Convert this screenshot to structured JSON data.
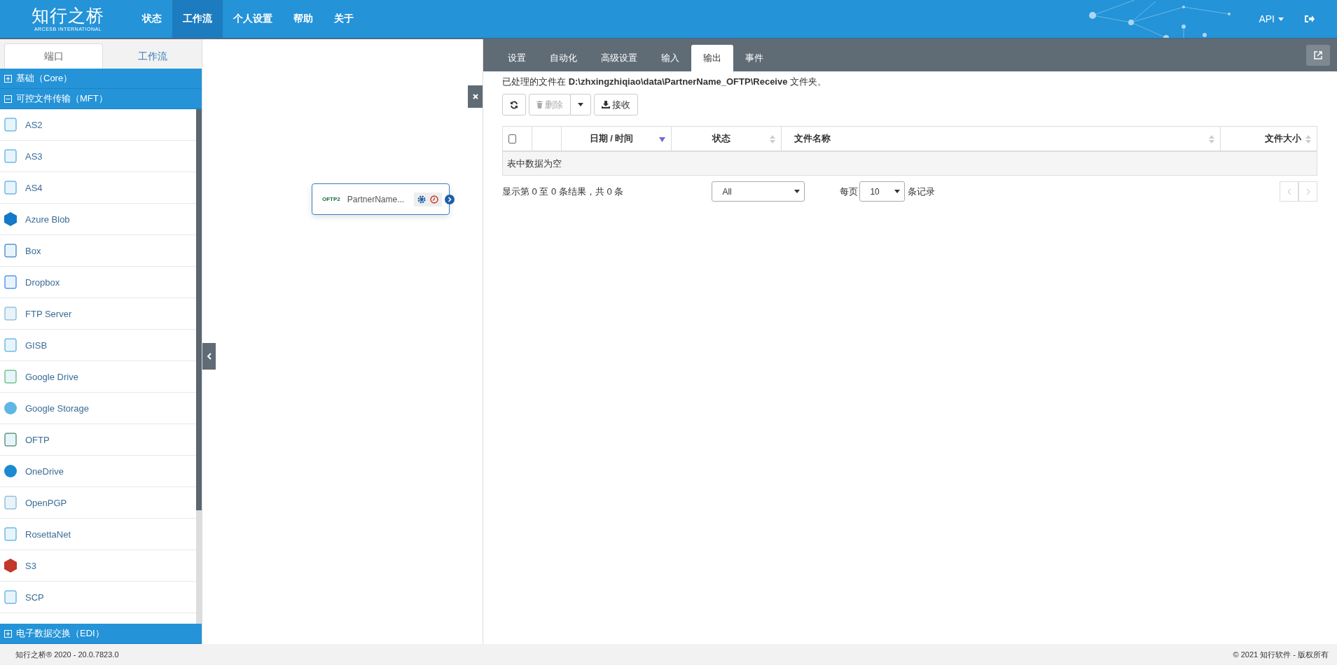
{
  "header": {
    "logo": "知行之桥",
    "logo_sub": "ARCESB INTERNATIONAL",
    "nav": [
      {
        "label": "状态",
        "selected": false
      },
      {
        "label": "工作流",
        "selected": true
      },
      {
        "label": "个人设置",
        "selected": false
      },
      {
        "label": "帮助",
        "selected": false
      },
      {
        "label": "关于",
        "selected": false
      }
    ],
    "api_menu": "API"
  },
  "sidebar": {
    "tabs": [
      {
        "label": "端口",
        "selected": true
      },
      {
        "label": "工作流",
        "selected": false
      }
    ],
    "groups": [
      {
        "label": "基础（Core）",
        "expanded": false
      },
      {
        "label": "可控文件传输（MFT）",
        "expanded": true,
        "items": [
          {
            "label": "AS2"
          },
          {
            "label": "AS3"
          },
          {
            "label": "AS4"
          },
          {
            "label": "Azure Blob"
          },
          {
            "label": "Box"
          },
          {
            "label": "Dropbox"
          },
          {
            "label": "FTP Server"
          },
          {
            "label": "GISB"
          },
          {
            "label": "Google Drive"
          },
          {
            "label": "Google Storage"
          },
          {
            "label": "OFTP"
          },
          {
            "label": "OneDrive"
          },
          {
            "label": "OpenPGP"
          },
          {
            "label": "RosettaNet"
          },
          {
            "label": "S3"
          },
          {
            "label": "SCP"
          }
        ]
      }
    ],
    "bottom_group": {
      "label": "电子数据交换（EDI）",
      "expanded": false
    }
  },
  "canvas": {
    "node": {
      "badge": "OFTP2",
      "label": "PartnerName..."
    }
  },
  "panel": {
    "tabs": [
      {
        "label": "设置",
        "selected": false
      },
      {
        "label": "自动化",
        "selected": false
      },
      {
        "label": "高级设置",
        "selected": false
      },
      {
        "label": "输入",
        "selected": false
      },
      {
        "label": "输出",
        "selected": true
      },
      {
        "label": "事件",
        "selected": false
      }
    ],
    "path_note": "已处理的文件在 **D:\\zhxingzhiqiao\\data\\PartnerName_OFTP\\Receive** 文件夹。",
    "toolbar": [
      {
        "kind": "refresh",
        "disabled": false
      },
      {
        "kind": "delete",
        "label": "删除",
        "disabled": true
      },
      {
        "kind": "caret",
        "disabled": false
      },
      {
        "kind": "receive",
        "label": "接收",
        "disabled": false
      }
    ],
    "table": {
      "select_all": {
        "checked": false
      },
      "columns": [
        {
          "label": "日期 / 时间",
          "sorted": true
        },
        {
          "label": "状态",
          "sorted": false
        },
        {
          "label": "文件名称",
          "sorted": false
        },
        {
          "label": "文件大小",
          "sorted": false
        }
      ],
      "empty": "表中数据为空"
    },
    "info": "显示第 0 至 0 条结果，共 0 条",
    "filter": "All",
    "page_size_label": "每页",
    "page_size": "10",
    "page_size_suffix": "条记录",
    "pager": {
      "prev_disabled": true,
      "next_disabled": true
    }
  },
  "footer": {
    "left": "知行之桥® 2020 - 20.0.7823.0",
    "right": "© 2021 知行软件 - 版权所有"
  }
}
